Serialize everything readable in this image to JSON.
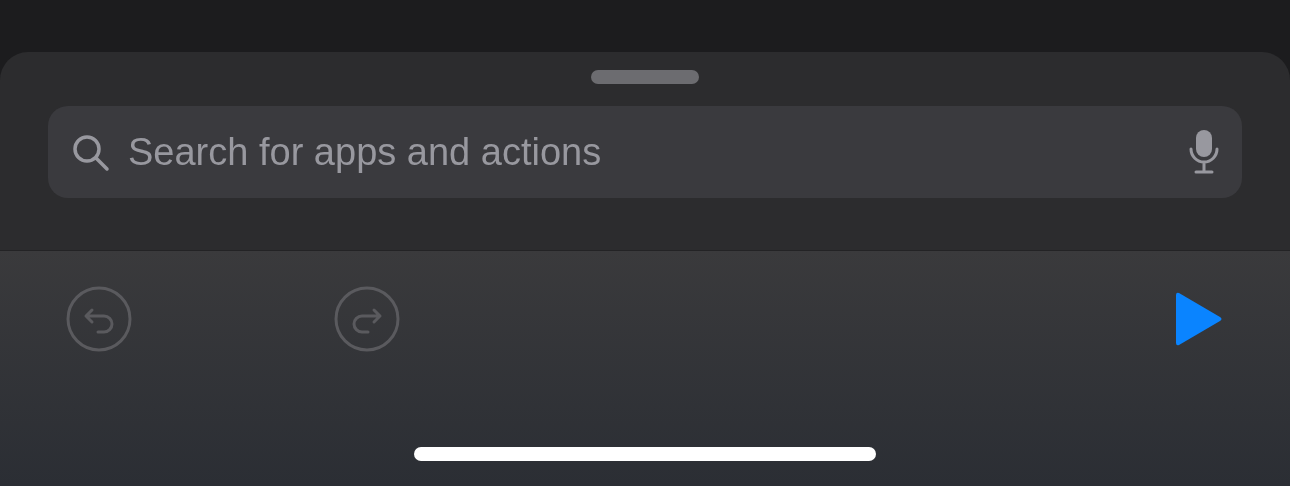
{
  "search": {
    "placeholder": "Search for apps and actions"
  },
  "toolbar": {
    "undo": {
      "disabled": true
    },
    "redo": {
      "disabled": true
    },
    "run": {
      "disabled": false
    }
  }
}
